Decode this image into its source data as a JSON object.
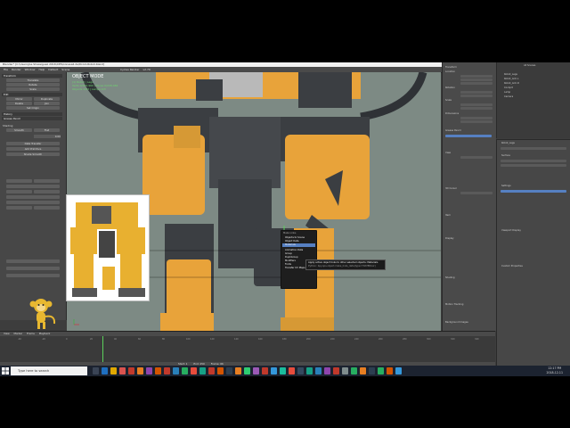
{
  "window": {
    "title": "Blender* [C:\\Users\\Joe Shassiguez 2016\\XPS\\Conesall.de\\Droid-Robot.blend]",
    "controls": "— ❐ ✕"
  },
  "menubar": {
    "left": [
      "File",
      "Render",
      "Window",
      "Help",
      "Default",
      "Scene"
    ],
    "mid": [
      "Cycles Render",
      "v2.79"
    ]
  },
  "toolshelf": {
    "sections": [
      "Transform",
      "Edit",
      "History",
      "Grease Pencil"
    ],
    "buttons": [
      "Translate",
      "Rotate",
      "Scale",
      "Mirror",
      "Duplicate",
      "Delete",
      "Join",
      "Set Origin",
      "Shading",
      "Smooth",
      "Flat",
      "Data Transfer",
      "Add Primitive",
      "Shade Smooth"
    ],
    "field_value": "0.00"
  },
  "viewport": {
    "mode_label": "OBJECT MODE",
    "info_lines": [
      "(1) Robot | Legs",
      "Verts 0/245,960 | Faces 0/228,484",
      "Objects 1/63 | Lamps 0/3"
    ]
  },
  "context_menu": {
    "title": "Make Links",
    "items": [
      "Objects to Scene",
      "Object Data",
      "Materials",
      "Animation Data",
      "Group",
      "DupliGroup",
      "Modifiers",
      "Fonts",
      "Transfer UV Maps"
    ],
    "highlighted_index": 2
  },
  "tooltip": {
    "text": "Apply active object links to other selected objects:  Materials",
    "python": "Python: bpy.ops.object.make_links_data(type='MATERIAL')"
  },
  "properties": {
    "panels": [
      "Transform",
      "Location",
      "Rotation",
      "Scale",
      "Dimensions",
      "Grease Pencil",
      "View",
      "3D Cursor",
      "Item",
      "Display",
      "Shading",
      "Motion Tracking",
      "Background Images"
    ]
  },
  "outliner": {
    "header": "All Scenes",
    "items": [
      "Robot_Legs",
      "Robot_Arm.L",
      "Robot_Arm.R",
      "Cockpit",
      "Lamp",
      "Camera"
    ]
  },
  "property_editor": {
    "header": "Robot_Legs",
    "panels": [
      "Surface",
      "Settings",
      "Viewport Display",
      "Custom Properties"
    ]
  },
  "timeline": {
    "header": [
      "View",
      "Marker",
      "Frame",
      "Playback"
    ],
    "footer": [
      "Start: 1",
      "End: 250",
      "Frame: 66"
    ],
    "ticks": [
      "-40",
      "-20",
      "0",
      "20",
      "40",
      "60",
      "80",
      "100",
      "120",
      "140",
      "160",
      "180",
      "200",
      "220",
      "240",
      "260",
      "280",
      "300",
      "320",
      "340"
    ]
  },
  "taskbar": {
    "search_placeholder": "Type here to search",
    "time": "12:17 PM",
    "date": "2018-12-11"
  },
  "colors": {
    "robot_yellow": "#e8a33a",
    "robot_dark": "#3b3e42",
    "viewport_bg": "#7d8a84",
    "highlight_blue": "#5680c2"
  }
}
